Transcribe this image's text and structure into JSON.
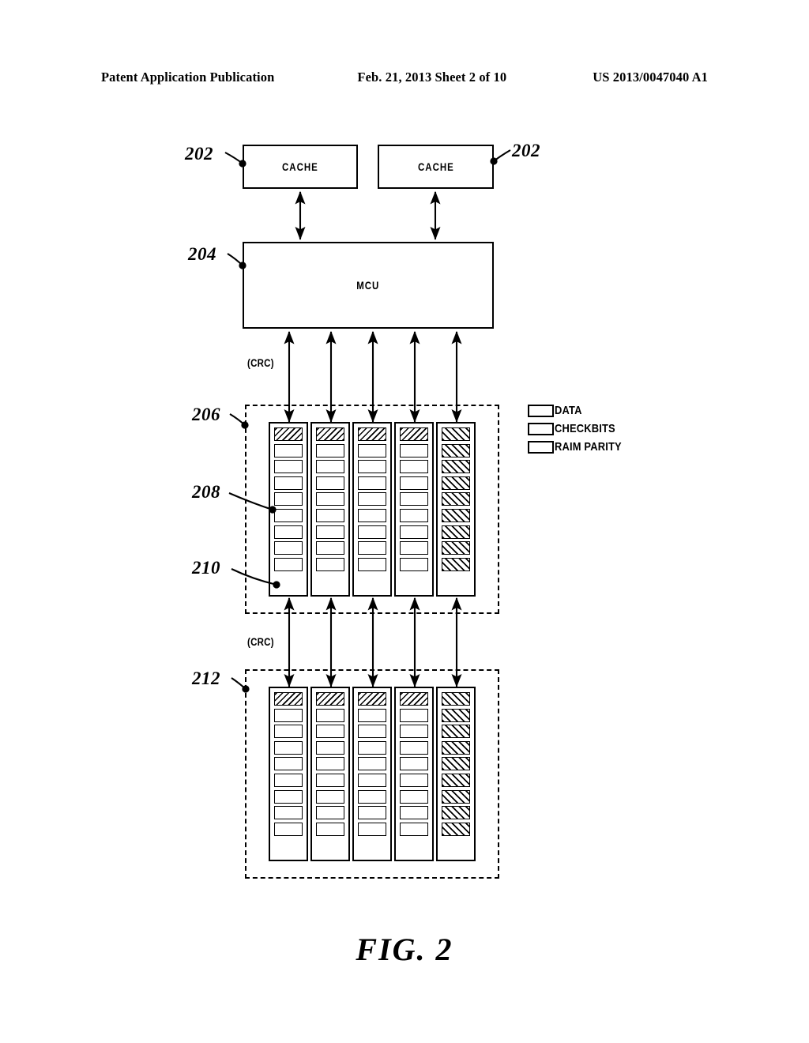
{
  "header": {
    "left": "Patent Application Publication",
    "middle": "Feb. 21, 2013  Sheet 2 of 10",
    "right": "US 2013/0047040 A1"
  },
  "figure": {
    "caption": "FIG.  2",
    "blocks": {
      "cache_left": {
        "label": "CACHE",
        "ref": "202"
      },
      "cache_right": {
        "label": "CACHE",
        "ref": "202"
      },
      "mcu": {
        "label": "MCU",
        "ref": "204"
      }
    },
    "bus_labels": {
      "upper_crc": "(CRC)",
      "lower_crc": "(CRC)"
    },
    "refs": {
      "memory_group_upper": "206",
      "dimm": "208",
      "memory_cell": "210",
      "memory_group_lower": "212"
    },
    "legend": {
      "items": [
        {
          "label": "DATA",
          "fill": "none"
        },
        {
          "label": "CHECKBITS",
          "fill": "checkbits-hatch"
        },
        {
          "label": "RAIM PARITY",
          "fill": "raim-hatch"
        }
      ]
    },
    "memory": {
      "columns_per_group": 5,
      "cells_per_column": 9,
      "groups": [
        {
          "ref": "206",
          "columns": [
            {
              "cells": [
                "checkbits",
                "data",
                "data",
                "data",
                "data",
                "data",
                "data",
                "data",
                "data"
              ]
            },
            {
              "cells": [
                "checkbits",
                "data",
                "data",
                "data",
                "data",
                "data",
                "data",
                "data",
                "data"
              ]
            },
            {
              "cells": [
                "checkbits",
                "data",
                "data",
                "data",
                "data",
                "data",
                "data",
                "data",
                "data"
              ]
            },
            {
              "cells": [
                "checkbits",
                "data",
                "data",
                "data",
                "data",
                "data",
                "data",
                "data",
                "data"
              ]
            },
            {
              "cells": [
                "raim",
                "raim",
                "raim",
                "raim",
                "raim",
                "raim",
                "raim",
                "raim",
                "raim"
              ]
            }
          ]
        },
        {
          "ref": "212",
          "columns": [
            {
              "cells": [
                "checkbits",
                "data",
                "data",
                "data",
                "data",
                "data",
                "data",
                "data",
                "data"
              ]
            },
            {
              "cells": [
                "checkbits",
                "data",
                "data",
                "data",
                "data",
                "data",
                "data",
                "data",
                "data"
              ]
            },
            {
              "cells": [
                "checkbits",
                "data",
                "data",
                "data",
                "data",
                "data",
                "data",
                "data",
                "data"
              ]
            },
            {
              "cells": [
                "checkbits",
                "data",
                "data",
                "data",
                "data",
                "data",
                "data",
                "data",
                "data"
              ]
            },
            {
              "cells": [
                "raim",
                "raim",
                "raim",
                "raim",
                "raim",
                "raim",
                "raim",
                "raim",
                "raim"
              ]
            }
          ]
        }
      ]
    }
  },
  "colors": {
    "ink": "#000000",
    "paper": "#ffffff"
  }
}
